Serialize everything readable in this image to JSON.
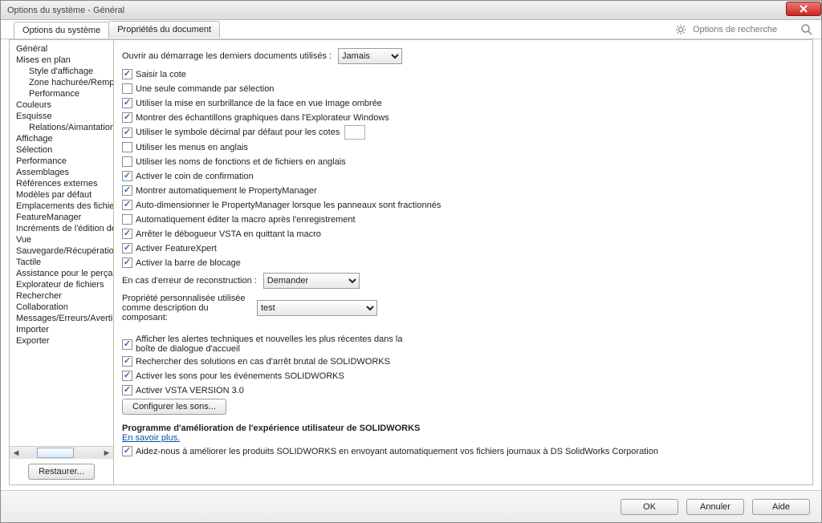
{
  "window": {
    "title": "Options du système - Général"
  },
  "tabs": {
    "system": "Options du système",
    "document": "Propriétés du document"
  },
  "search": {
    "placeholder": "Options de recherche"
  },
  "sidebar": {
    "items": [
      "Général",
      "Mises en plan",
      "Style d'affichage",
      "Zone hachurée/Remplir",
      "Performance",
      "Couleurs",
      "Esquisse",
      "Relations/Aimantation",
      "Affichage",
      "Sélection",
      "Performance",
      "Assemblages",
      "Références externes",
      "Modèles par défaut",
      "Emplacements des fichiers",
      "FeatureManager",
      "Incréments de l'édition de c",
      "Vue",
      "Sauvegarde/Récupération",
      "Tactile",
      "Assistance pour le perçage/",
      "Explorateur de fichiers",
      "Rechercher",
      "Collaboration",
      "Messages/Erreurs/Avertissem",
      "Importer",
      "Exporter"
    ],
    "restore": "Restaurer..."
  },
  "content": {
    "open_recent_label": "Ouvrir au démarrage les derniers documents utilisés :",
    "open_recent_value": "Jamais",
    "chk": [
      {
        "text": "Saisir la cote",
        "checked": true
      },
      {
        "text": "Une seule commande par sélection",
        "checked": false
      },
      {
        "text": "Utiliser la mise en surbrillance de la face en vue Image ombrée",
        "checked": true
      },
      {
        "text": "Montrer des échantillons graphiques dans l'Explorateur Windows",
        "checked": true
      },
      {
        "text": "Utiliser le symbole décimal par défaut pour les cotes",
        "checked": true,
        "has_input": true
      },
      {
        "text": "Utiliser les menus en anglais",
        "checked": false
      },
      {
        "text": "Utiliser les noms de fonctions et de fichiers en anglais",
        "checked": false
      },
      {
        "text": "Activer le coin de confirmation",
        "checked": true
      },
      {
        "text": "Montrer automatiquement le PropertyManager",
        "checked": true
      },
      {
        "text": "Auto-dimensionner le PropertyManager lorsque les panneaux sont fractionnés",
        "checked": true
      },
      {
        "text": "Automatiquement éditer la macro après l'enregistrement",
        "checked": false
      },
      {
        "text": "Arrêter le débogueur VSTA en quittant la macro",
        "checked": true
      },
      {
        "text": "Activer FeatureXpert",
        "checked": true
      },
      {
        "text": "Activer la barre de blocage",
        "checked": true
      }
    ],
    "rebuild_error_label": "En cas d'erreur de reconstruction :",
    "rebuild_error_value": "Demander",
    "custom_prop_label": "Propriété personnalisée utilisée comme description du composant:",
    "custom_prop_value": "test",
    "chk2": [
      {
        "text": "Afficher les alertes techniques et nouvelles les plus récentes dans la boîte de dialogue d'accueil",
        "checked": true
      },
      {
        "text": "Rechercher des solutions en cas d'arrêt brutal de SOLIDWORKS",
        "checked": true
      },
      {
        "text": "Activer les sons pour les événements SOLIDWORKS",
        "checked": true
      },
      {
        "text": "Activer VSTA VERSION 3.0",
        "checked": true
      }
    ],
    "configure_sounds": "Configurer les sons...",
    "improvement_title": "Programme d'amélioration de l'expérience utilisateur de SOLIDWORKS",
    "learn_more": "En savoir plus.",
    "improvement_chk": {
      "text": "Aidez-nous à améliorer les produits SOLIDWORKS en envoyant automatiquement vos fichiers journaux à DS SolidWorks Corporation",
      "checked": true
    }
  },
  "footer": {
    "ok": "OK",
    "cancel": "Annuler",
    "help": "Aide"
  }
}
